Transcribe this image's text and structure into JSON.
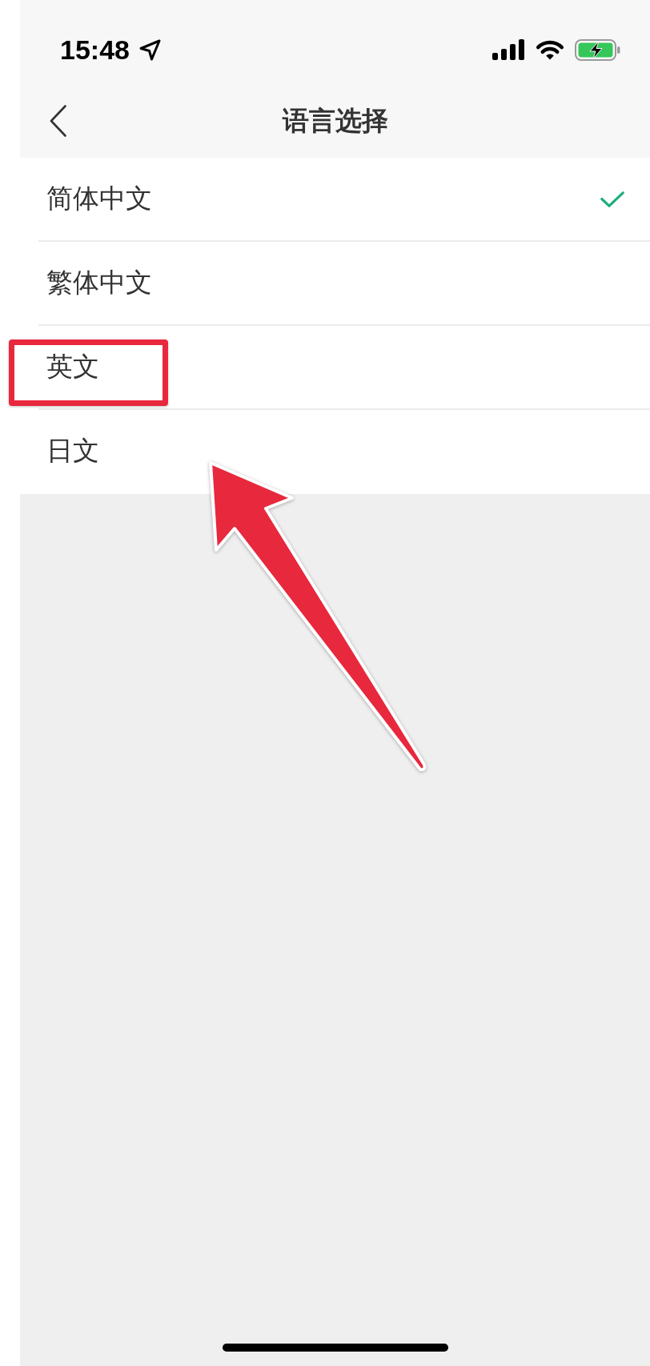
{
  "status_bar": {
    "time": "15:48"
  },
  "nav_bar": {
    "title": "语言选择"
  },
  "languages": [
    {
      "label": "简体中文",
      "selected": true,
      "highlighted": false
    },
    {
      "label": "繁体中文",
      "selected": false,
      "highlighted": false
    },
    {
      "label": "英文",
      "selected": false,
      "highlighted": true
    },
    {
      "label": "日文",
      "selected": false,
      "highlighted": false
    }
  ]
}
